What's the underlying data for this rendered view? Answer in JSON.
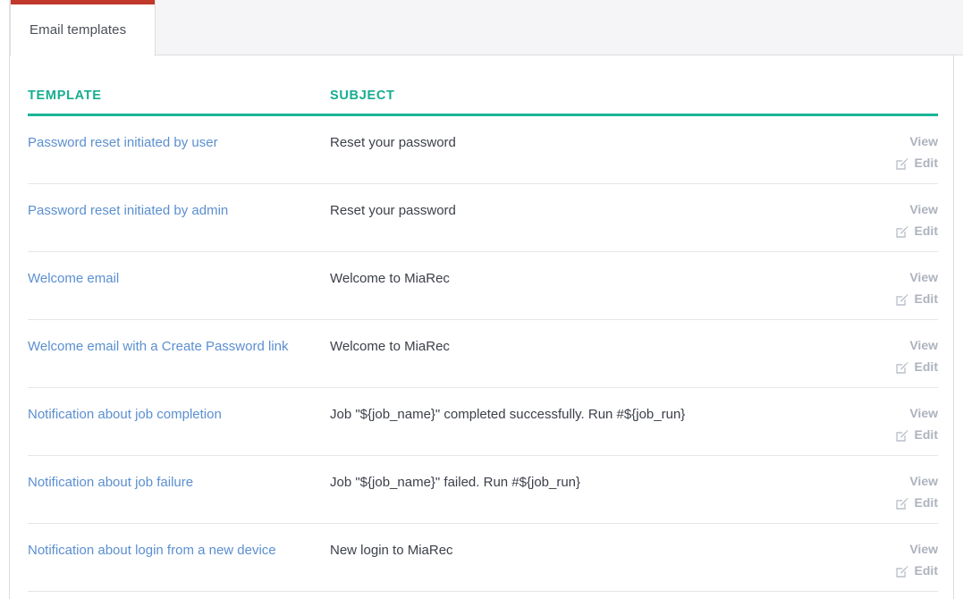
{
  "window": {
    "accent_red": "#c0392b",
    "accent_teal": "#19b698",
    "link_blue": "#5b8fd0",
    "action_gray": "#adb2bd"
  },
  "tabs": [
    {
      "label": "Email templates",
      "active": true
    }
  ],
  "table": {
    "columns": {
      "template": "TEMPLATE",
      "subject": "SUBJECT",
      "actions": ""
    },
    "actions": {
      "view_label": "View",
      "edit_label": "Edit",
      "edit_icon": "pencil-square-icon"
    },
    "rows": [
      {
        "template": "Password reset initiated by user",
        "subject": "Reset your password"
      },
      {
        "template": "Password reset initiated by admin",
        "subject": "Reset your password"
      },
      {
        "template": "Welcome email",
        "subject": "Welcome to MiaRec"
      },
      {
        "template": "Welcome email with a Create Password link",
        "subject": "Welcome to MiaRec"
      },
      {
        "template": "Notification about job completion",
        "subject": "Job \"${job_name}\" completed successfully. Run #${job_run}"
      },
      {
        "template": "Notification about job failure",
        "subject": "Job \"${job_name}\" failed. Run #${job_run}"
      },
      {
        "template": "Notification about login from a new device",
        "subject": "New login to MiaRec"
      }
    ]
  }
}
